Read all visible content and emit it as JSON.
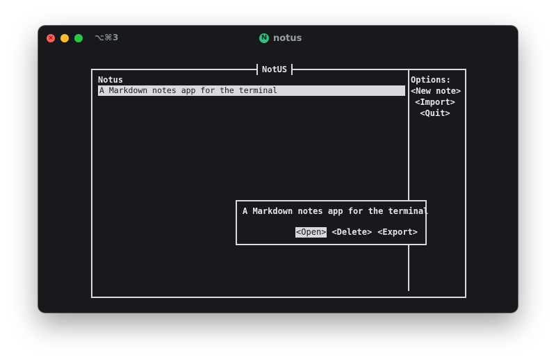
{
  "window": {
    "shortcut": "⌥⌘3",
    "title": "notus",
    "app_icon_letter": "N"
  },
  "frame": {
    "title": "NotUS"
  },
  "list": {
    "header": "Notus",
    "items": [
      {
        "label": "A Markdown notes app for the terminal",
        "selected": true
      }
    ]
  },
  "options": {
    "title": "Options:",
    "items": [
      "<New note>",
      "<Import>",
      "<Quit>"
    ]
  },
  "dialog": {
    "message": "A Markdown notes app for the terminal",
    "buttons": [
      {
        "label": "<Open>",
        "selected": true
      },
      {
        "label": "<Delete>",
        "selected": false
      },
      {
        "label": "<Export>",
        "selected": false
      }
    ]
  },
  "colors": {
    "window_bg": "#17191c",
    "foreground": "#e4e6e8",
    "highlight_bg": "#d8dadc",
    "traffic_red": "#fe5f57",
    "traffic_yellow": "#febc2e",
    "traffic_green": "#28c840",
    "app_icon": "#2ec27e"
  }
}
